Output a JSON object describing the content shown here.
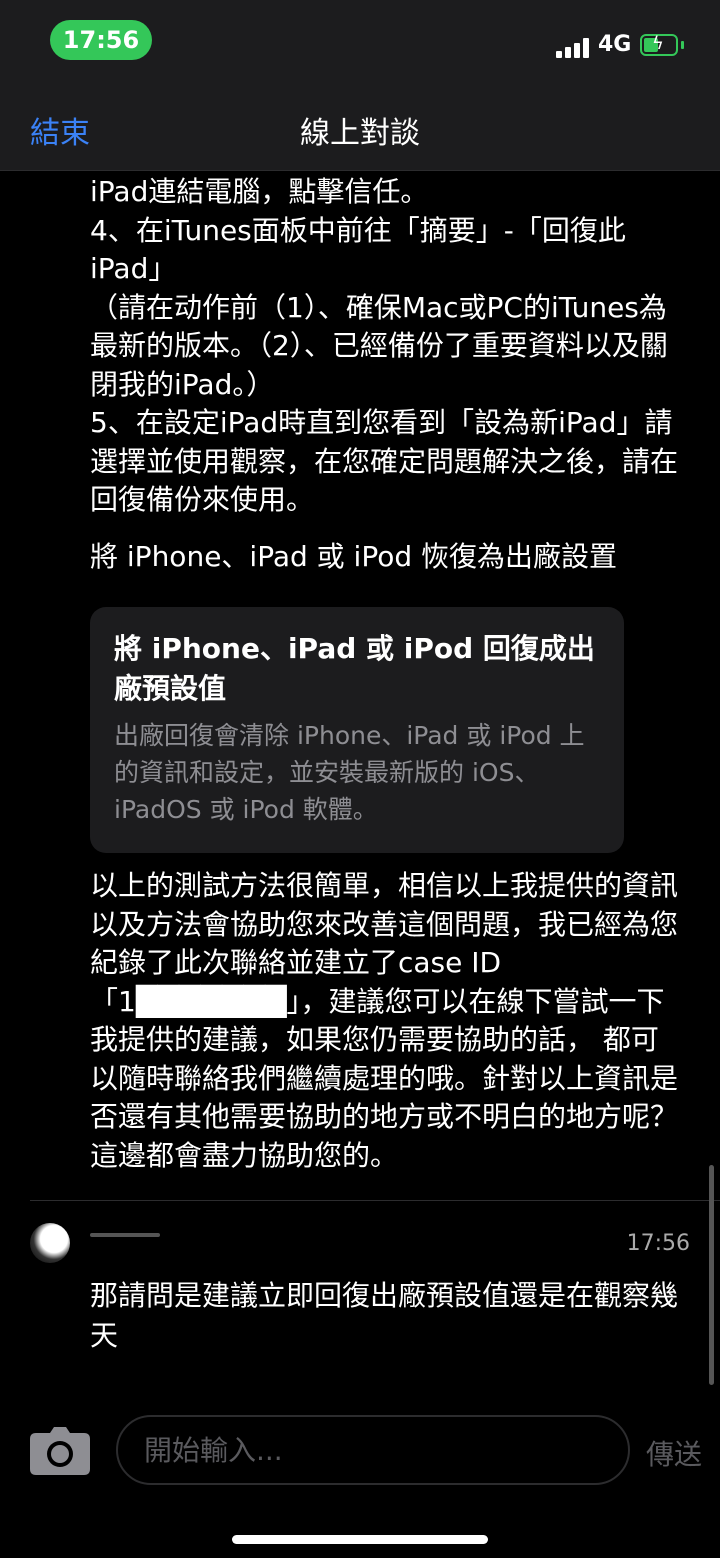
{
  "status_bar": {
    "time": "17:56",
    "network": "4G"
  },
  "nav": {
    "end_label": "結束",
    "title": "線上對談"
  },
  "agent_message": {
    "part1": "iPad連結電腦，點擊信任。\n4、在iTunes面板中前往「摘要」-「回復此iPad」\n（請在动作前（1）、確保Mac或PC的iTunes為最新的版本。（2）、已經備份了重要資料以及關閉我的iPad。）\n5、在設定iPad時直到您看到「設為新iPad」請選擇並使用觀察，在您確定問題解決之後，請在回復備份來使用。",
    "link_text": "將 iPhone、iPad 或 iPod 恢復為出廠設置",
    "link_card": {
      "title": "將 iPhone、iPad 或 iPod 回復成出廠預設值",
      "description": "出廠回復會清除 iPhone、iPad 或 iPod 上的資訊和設定，並安裝最新版的 iOS、iPadOS 或 iPod 軟體。"
    },
    "part2": "以上的測試方法很簡單，相信以上我提供的資訊以及方法會協助您來改善這個問題，我已經為您紀錄了此次聯絡並建立了case ID「1███████」，建議您可以在線下嘗試一下我提供的建議，如果您仍需要協助的話， 都可以隨時聯絡我們繼續處理的哦。針對以上資訊是否還有其他需要協助的地方或不明白的地方呢？這邊都會盡力協助您的。"
  },
  "user_message": {
    "time": "17:56",
    "text": "那請問是建議立即回復出廠預設值還是在觀察幾天"
  },
  "composer": {
    "placeholder": "開始輸入...",
    "send_label": "傳送"
  },
  "colors": {
    "accent": "#3b82f6",
    "status_green": "#34c759"
  }
}
